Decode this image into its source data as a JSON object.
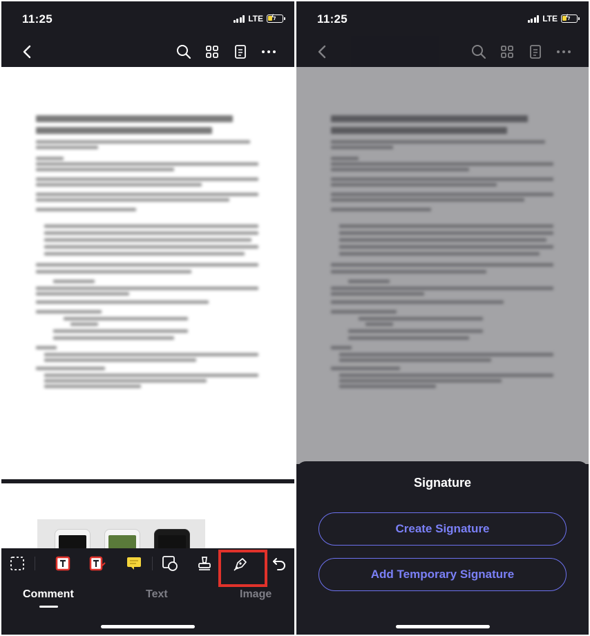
{
  "status": {
    "time": "11:25",
    "network": "LTE"
  },
  "left": {
    "tabs": [
      {
        "label": "Comment",
        "active": true
      },
      {
        "label": "Text",
        "active": false
      },
      {
        "label": "Image",
        "active": false
      }
    ],
    "toolbar_icons": [
      "select-icon",
      "text-box-icon",
      "text-callout-icon",
      "note-icon",
      "shape-icon",
      "stamp-icon",
      "signature-pen-icon",
      "undo-icon"
    ],
    "highlighted_tool": "signature-pen-icon",
    "highlight_color": "#e0322b"
  },
  "right": {
    "sheet": {
      "title": "Signature",
      "create_label": "Create Signature",
      "temporary_label": "Add Temporary Signature"
    }
  },
  "colors": {
    "background": "#1b1b21",
    "accent": "#6d72f0",
    "highlight": "#e0322b"
  }
}
